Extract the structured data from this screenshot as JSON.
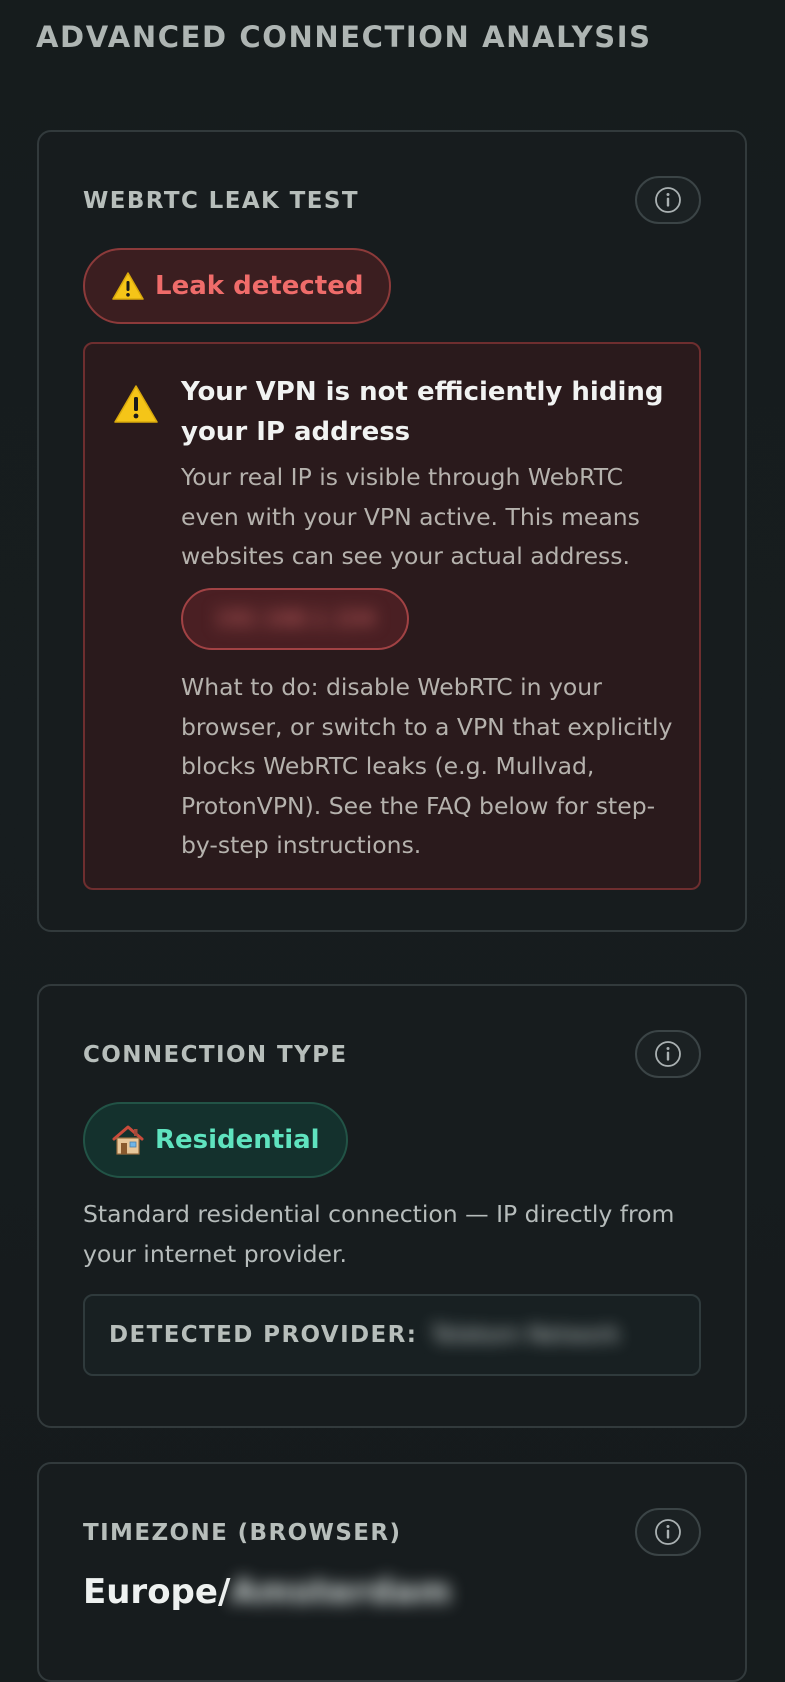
{
  "page": {
    "title": "ADVANCED CONNECTION ANALYSIS"
  },
  "webrtc": {
    "title": "WEBRTC LEAK TEST",
    "info_icon": "info-icon",
    "status_badge": "Leak detected",
    "status_icon": "warning-icon",
    "status_color": "#ef6c6a",
    "warning": {
      "icon": "warning-icon",
      "title": "Your VPN is not efficiently hiding your IP address",
      "description": "Your real IP is visible through WebRTC even with your VPN active. This means websites can see your actual address.",
      "leaked_ip": "192.168.1.104",
      "advice": "What to do: disable WebRTC in your browser, or switch to a VPN that explicitly blocks WebRTC leaks (e.g. Mullvad, ProtonVPN). See the FAQ below for step-by-step instructions."
    }
  },
  "connection": {
    "title": "CONNECTION TYPE",
    "info_icon": "info-icon",
    "type_badge": "Residential",
    "type_icon": "house-icon",
    "type_color": "#5fe3bf",
    "description": "Standard residential connection — IP directly from your internet provider.",
    "provider_label": "DETECTED PROVIDER:",
    "provider_value": "Telekom Network"
  },
  "timezone": {
    "title": "TIMEZONE (BROWSER)",
    "info_icon": "info-icon",
    "value_prefix": "Europe/",
    "value_hidden": "Amsterdam"
  }
}
